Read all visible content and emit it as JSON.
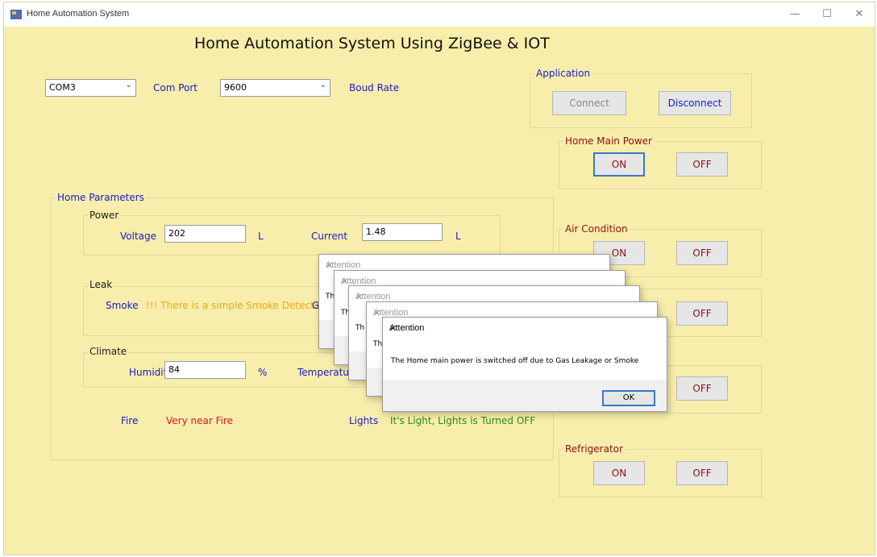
{
  "window": {
    "title": "Home Automation System",
    "controls": [
      "—",
      "☐",
      "✕"
    ]
  },
  "heading": "Home Automation System Using ZigBee & IOT",
  "connection": {
    "com_port_value": "COM3",
    "com_port_label": "Com Port",
    "baud_value": "9600",
    "baud_label": "Boud Rate"
  },
  "application": {
    "title": "Application",
    "connect": "Connect",
    "disconnect": "Disconnect"
  },
  "main_power": {
    "title": "Home Main Power",
    "on": "ON",
    "off": "OFF"
  },
  "air_condition": {
    "title": "Air Condition",
    "on": "ON",
    "off": "OFF"
  },
  "hidden_device_1": {
    "off": "OFF"
  },
  "hidden_device_2": {
    "off": "OFF"
  },
  "refrigerator": {
    "title": "Refrigerator",
    "on": "ON",
    "off": "OFF"
  },
  "parameters": {
    "title": "Home Parameters",
    "power": {
      "title": "Power",
      "voltage_label": "Voltage",
      "voltage_value": "202",
      "voltage_unit": "L",
      "current_label": "Current",
      "current_value": "1.48",
      "current_unit": "L"
    },
    "leak": {
      "title": "Leak",
      "smoke_label": "Smoke",
      "smoke_status": "!!! There is a simple Smoke Detected",
      "gas_label_partial": "G"
    },
    "climate": {
      "title": "Climate",
      "humidity_label": "Humidity",
      "humidity_value": "84",
      "humidity_unit": "%",
      "temperature_label_partial": "Temperatur"
    },
    "fire_label": "Fire",
    "fire_status": "Very near Fire",
    "lights_label": "Lights",
    "lights_status": "It's Light, Lights is Turned OFF"
  },
  "dialogs": {
    "title": "Attention",
    "close": "✕",
    "partial_texts": [
      "Th",
      "Th",
      "Th",
      "Th",
      "Th"
    ],
    "message": "The Home main power is switched off due to Gas Leakage or Smoke",
    "ok": "OK"
  }
}
